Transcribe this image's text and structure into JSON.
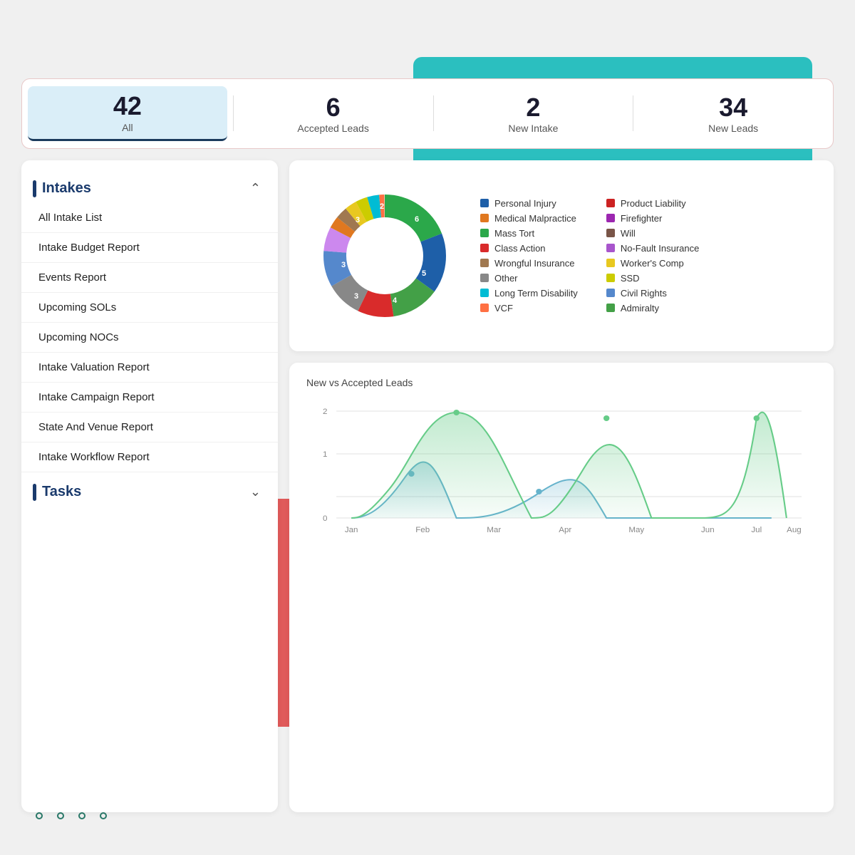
{
  "background": {
    "teal_color": "#2bbfbf",
    "red_color": "#e05a5a"
  },
  "stats": {
    "items": [
      {
        "number": "42",
        "label": "All",
        "active": true
      },
      {
        "number": "6",
        "label": "Accepted Leads",
        "active": false
      },
      {
        "number": "2",
        "label": "New Intake",
        "active": false
      },
      {
        "number": "34",
        "label": "New Leads",
        "active": false
      }
    ]
  },
  "sidebar": {
    "intakes_title": "Intakes",
    "tasks_title": "Tasks",
    "menu_items": [
      "All Intake List",
      "Intake Budget Report",
      "Events Report",
      "Upcoming SOLs",
      "Upcoming NOCs",
      "Intake Valuation Report",
      "Intake Campaign Report",
      "State And Venue Report",
      "Intake Workflow Report"
    ]
  },
  "donut_chart": {
    "legend": [
      {
        "label": "Personal Injury",
        "color": "#1e5fa8"
      },
      {
        "label": "Medical Malpractice",
        "color": "#e07820"
      },
      {
        "label": "Mass Tort",
        "color": "#2ba84a"
      },
      {
        "label": "Class Action",
        "color": "#d92b2b"
      },
      {
        "label": "No-Fault Insurance",
        "color": "#a855cc"
      },
      {
        "label": "Wrongful Insurance",
        "color": "#a07850"
      },
      {
        "label": "Worker's Comp",
        "color": "#e8c820"
      },
      {
        "label": "Other",
        "color": "#888888"
      },
      {
        "label": "SSD",
        "color": "#cccc00"
      },
      {
        "label": "Long Term Disability",
        "color": "#00bcd4"
      },
      {
        "label": "Civil Rights",
        "color": "#5588cc"
      },
      {
        "label": "VCF",
        "color": "#ff7043"
      },
      {
        "label": "Admiralty",
        "color": "#43a047"
      },
      {
        "label": "Product Liability",
        "color": "#cc2222"
      },
      {
        "label": "Firefighter",
        "color": "#9c27b0"
      },
      {
        "label": "Will",
        "color": "#795548"
      }
    ],
    "segments": [
      {
        "value": 6,
        "color": "#2ba84a",
        "label": "6"
      },
      {
        "value": 5,
        "color": "#1e5fa8",
        "label": "5"
      },
      {
        "value": 4,
        "color": "#43a047",
        "label": "4"
      },
      {
        "value": 3,
        "color": "#d92b2b",
        "label": "3"
      },
      {
        "value": 3,
        "color": "#888888",
        "label": "3"
      },
      {
        "value": 3,
        "color": "#5588cc",
        "label": "3"
      },
      {
        "value": 2,
        "color": "#cc88ee",
        "label": "2"
      },
      {
        "value": 1,
        "color": "#e07820",
        "label": ""
      },
      {
        "value": 1,
        "color": "#a07850",
        "label": ""
      },
      {
        "value": 1,
        "color": "#e8c820",
        "label": ""
      },
      {
        "value": 1,
        "color": "#cccc00",
        "label": ""
      },
      {
        "value": 1,
        "color": "#00bcd4",
        "label": ""
      },
      {
        "value": 1,
        "color": "#ff7043",
        "label": ""
      }
    ]
  },
  "line_chart": {
    "title": "New vs Accepted Leads",
    "x_labels": [
      "Jan",
      "Feb",
      "Mar",
      "Apr",
      "May",
      "Jun",
      "Jul",
      "Aug"
    ],
    "y_max": 2,
    "accepted_color": "#66b3cc",
    "new_color": "#66cc88"
  }
}
